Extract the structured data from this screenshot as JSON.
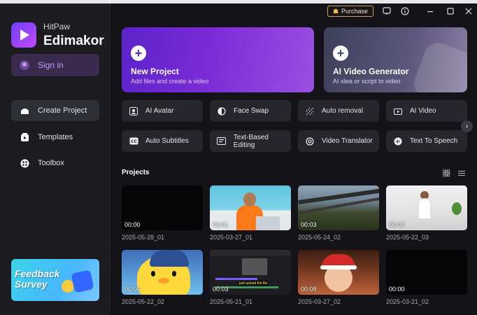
{
  "app": {
    "brand": "HitPaw",
    "name": "Edimakor"
  },
  "sidebar": {
    "signin_label": "Sign in",
    "items": [
      {
        "label": "Create Project",
        "icon": "create-project-icon",
        "active": true
      },
      {
        "label": "Templates",
        "icon": "templates-icon",
        "active": false
      },
      {
        "label": "Toolbox",
        "icon": "toolbox-icon",
        "active": false
      }
    ],
    "feedback_label": "Feedback Survey"
  },
  "titlebar": {
    "purchase_label": "Purchase",
    "icons": [
      "feedback-icon",
      "info-icon",
      "minimize-icon",
      "maximize-icon",
      "close-icon"
    ]
  },
  "hero": {
    "new_project": {
      "title": "New Project",
      "subtitle": "Add files and create a video"
    },
    "ai_video_generator": {
      "title": "AI Video Generator",
      "subtitle": "AI idea or script to video"
    }
  },
  "tools": [
    {
      "label": "AI Avatar",
      "icon": "avatar-icon"
    },
    {
      "label": "Face Swap",
      "icon": "face-swap-icon"
    },
    {
      "label": "Auto removal",
      "icon": "auto-removal-icon"
    },
    {
      "label": "AI Video",
      "icon": "ai-video-icon"
    },
    {
      "label": "Auto Subtitles",
      "icon": "cc-icon"
    },
    {
      "label": "Text-Based Editing",
      "icon": "text-edit-icon"
    },
    {
      "label": "Video Translator",
      "icon": "translator-icon"
    },
    {
      "label": "Text To Speech",
      "icon": "tts-icon"
    }
  ],
  "projects": {
    "title": "Projects",
    "items": [
      {
        "name": "2025-05-28_01",
        "duration": "00:00",
        "thumb": "black"
      },
      {
        "name": "2025-03-27_01",
        "duration": "00:01",
        "thumb": "person"
      },
      {
        "name": "2025-05-24_02",
        "duration": "00:03",
        "thumb": "bridge"
      },
      {
        "name": "2025-05-22_03",
        "duration": "00:03",
        "thumb": "kitchen"
      },
      {
        "name": "2025-05-22_02",
        "duration": "00:04",
        "thumb": "duck"
      },
      {
        "name": "2025-05-21_01",
        "duration": "00:03",
        "thumb": "editor"
      },
      {
        "name": "2025-03-27_02",
        "duration": "00:08",
        "thumb": "girl"
      },
      {
        "name": "2025-03-21_02",
        "duration": "00:00",
        "thumb": "black"
      }
    ]
  },
  "editor_thumb_caption": "just upload the file",
  "colors": {
    "accent_purple": "#7b2bd8",
    "signin_text": "#c69cff",
    "purchase_border": "#d0a44a"
  }
}
